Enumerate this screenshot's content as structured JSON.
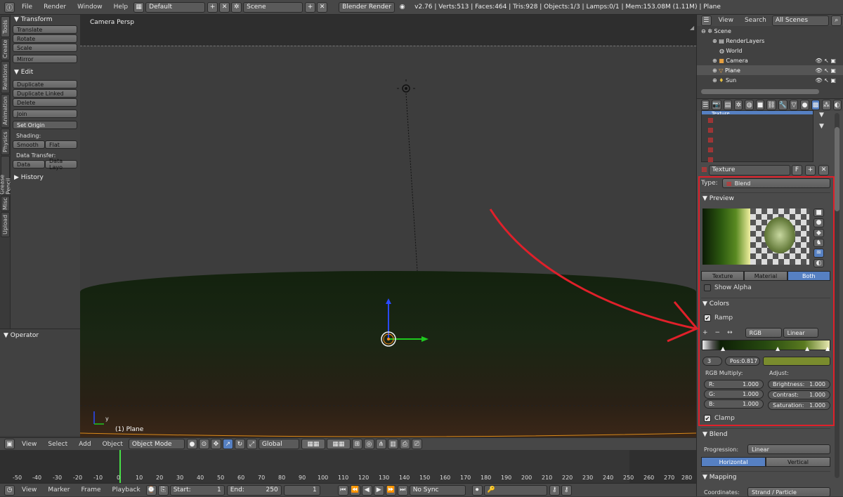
{
  "topbar": {
    "menus": [
      "File",
      "Render",
      "Window",
      "Help"
    ],
    "layout": "Default",
    "scene": "Scene",
    "engine": "Blender Render",
    "stats": "v2.76 | Verts:513 | Faces:464 | Tris:928 | Objects:1/3 | Lamps:0/1 | Mem:153.08M (1.11M) | Plane"
  },
  "vtabs": [
    "Tools",
    "Create",
    "Relations",
    "Animation",
    "Physics",
    "Grease Pencil",
    "Misc",
    "Upload"
  ],
  "toolshelf": {
    "transform_header": "Transform",
    "translate": "Translate",
    "rotate": "Rotate",
    "scale": "Scale",
    "mirror": "Mirror",
    "edit_header": "Edit",
    "duplicate": "Duplicate",
    "duplicate_linked": "Duplicate Linked",
    "delete": "Delete",
    "join": "Join",
    "set_origin": "Set Origin",
    "shading_label": "Shading:",
    "smooth": "Smooth",
    "flat": "Flat",
    "data_transfer_label": "Data Transfer:",
    "data": "Data",
    "data_layo": "Data Layo",
    "history": "History"
  },
  "operator": {
    "header": "Operator"
  },
  "viewport": {
    "label": "Camera Persp",
    "object_label": "(1) Plane"
  },
  "view_header": {
    "view": "View",
    "select": "Select",
    "add": "Add",
    "object": "Object",
    "mode": "Object Mode",
    "orientation": "Global"
  },
  "timeline": {
    "ticks": [
      "-50",
      "-40",
      "-30",
      "-20",
      "-10",
      "0",
      "10",
      "20",
      "30",
      "40",
      "50",
      "60",
      "70",
      "80",
      "90",
      "100",
      "110",
      "120",
      "130",
      "140",
      "150",
      "160",
      "170",
      "180",
      "190",
      "200",
      "210",
      "220",
      "230",
      "240",
      "250",
      "260",
      "270",
      "280"
    ],
    "current_frame": 1
  },
  "tl_header": {
    "view": "View",
    "marker": "Marker",
    "frame": "Frame",
    "playback": "Playback",
    "start_label": "Start:",
    "start": "1",
    "end_label": "End:",
    "end": "250",
    "frame_value": "1",
    "sync": "No Sync"
  },
  "outliner": {
    "view": "View",
    "search": "Search",
    "scenes": "All Scenes",
    "items": [
      "Scene",
      "RenderLayers",
      "World",
      "Camera",
      "Plane",
      "Sun"
    ]
  },
  "properties": {
    "slot_name": "Texture",
    "texture_name": "Texture",
    "texture_flag": "F",
    "type_label": "Type:",
    "type_value": "Blend",
    "preview_header": "Preview",
    "preview_tabs": [
      "Texture",
      "Material",
      "Both"
    ],
    "show_alpha": "Show Alpha",
    "colors_header": "Colors",
    "ramp": "Ramp",
    "ramp_color_mode": "RGB",
    "ramp_interp": "Linear",
    "ramp_index": "3",
    "ramp_pos": "Pos:0.817",
    "ramp_color": "#7a8c2e",
    "rgb_multiply_label": "RGB Multiply:",
    "r_label": "R:",
    "r_value": "1.000",
    "g_label": "G:",
    "g_value": "1.000",
    "b_label": "B:",
    "b_value": "1.000",
    "adjust_label": "Adjust:",
    "brightness_label": "Brightness:",
    "brightness_value": "1.000",
    "contrast_label": "Contrast:",
    "contrast_value": "1.000",
    "saturation_label": "Saturation:",
    "saturation_value": "1.000",
    "clamp": "Clamp",
    "blend_header": "Blend",
    "progression_label": "Progression:",
    "progression_value": "Linear",
    "direction_tabs": [
      "Horizontal",
      "Vertical"
    ],
    "mapping_header": "Mapping",
    "coordinates_label": "Coordinates:",
    "coordinates_value": "Strand / Particle"
  },
  "colors": {
    "accent": "#5680c2",
    "highlight_box": "#e0202a",
    "arrow": "#e0202a"
  }
}
